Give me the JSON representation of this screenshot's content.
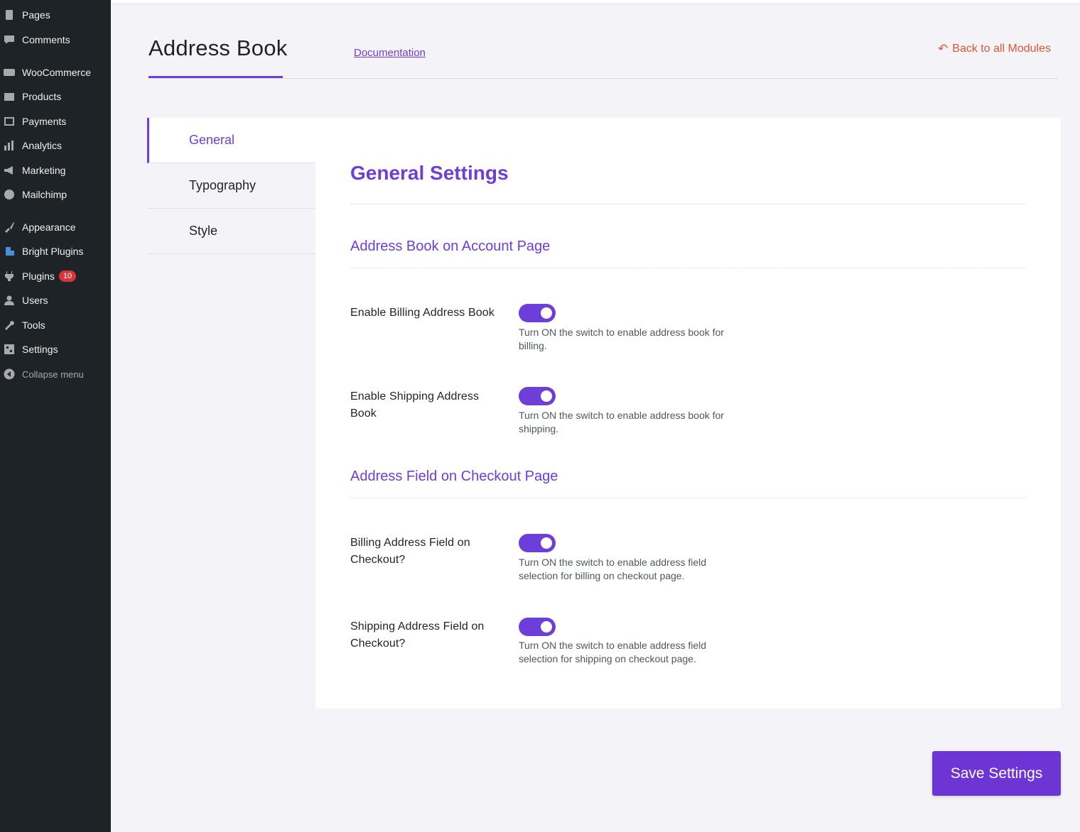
{
  "sidebar": {
    "items": [
      {
        "label": "Pages",
        "icon": "pages-icon"
      },
      {
        "label": "Comments",
        "icon": "comments-icon"
      },
      {
        "label": "WooCommerce",
        "icon": "woocommerce-icon"
      },
      {
        "label": "Products",
        "icon": "products-icon"
      },
      {
        "label": "Payments",
        "icon": "payments-icon"
      },
      {
        "label": "Analytics",
        "icon": "analytics-icon"
      },
      {
        "label": "Marketing",
        "icon": "marketing-icon"
      },
      {
        "label": "Mailchimp",
        "icon": "mailchimp-icon"
      },
      {
        "label": "Appearance",
        "icon": "appearance-icon"
      },
      {
        "label": "Bright Plugins",
        "icon": "bright-plugins-icon"
      },
      {
        "label": "Plugins",
        "icon": "plugins-icon",
        "badge": "10"
      },
      {
        "label": "Users",
        "icon": "users-icon"
      },
      {
        "label": "Tools",
        "icon": "tools-icon"
      },
      {
        "label": "Settings",
        "icon": "settings-icon"
      },
      {
        "label": "Collapse menu",
        "icon": "collapse-icon"
      }
    ]
  },
  "header": {
    "title": "Address Book",
    "doc_link": "Documentation",
    "back_link": "Back to all Modules"
  },
  "tabs": [
    {
      "label": "General",
      "active": true
    },
    {
      "label": "Typography",
      "active": false
    },
    {
      "label": "Style",
      "active": false
    }
  ],
  "content": {
    "title": "General Settings",
    "sections": [
      {
        "title": "Address Book on Account Page",
        "fields": [
          {
            "label": "Enable Billing Address Book",
            "enabled": true,
            "description": "Turn ON the switch to enable address book for billing."
          },
          {
            "label": "Enable Shipping Address Book",
            "enabled": true,
            "description": "Turn ON the switch to enable address book for shipping."
          }
        ]
      },
      {
        "title": "Address Field on Checkout Page",
        "fields": [
          {
            "label": "Billing Address Field on Checkout?",
            "enabled": true,
            "description": "Turn ON the switch to enable address field selection for billing on checkout page."
          },
          {
            "label": "Shipping Address Field on Checkout?",
            "enabled": true,
            "description": "Turn ON the switch to enable address field selection for shipping on checkout page."
          }
        ]
      }
    ]
  },
  "save_button": "Save Settings",
  "colors": {
    "accent": "#6d3ed8",
    "back_link": "#e05333",
    "sidebar_bg": "#1d2327",
    "badge": "#d63638"
  }
}
